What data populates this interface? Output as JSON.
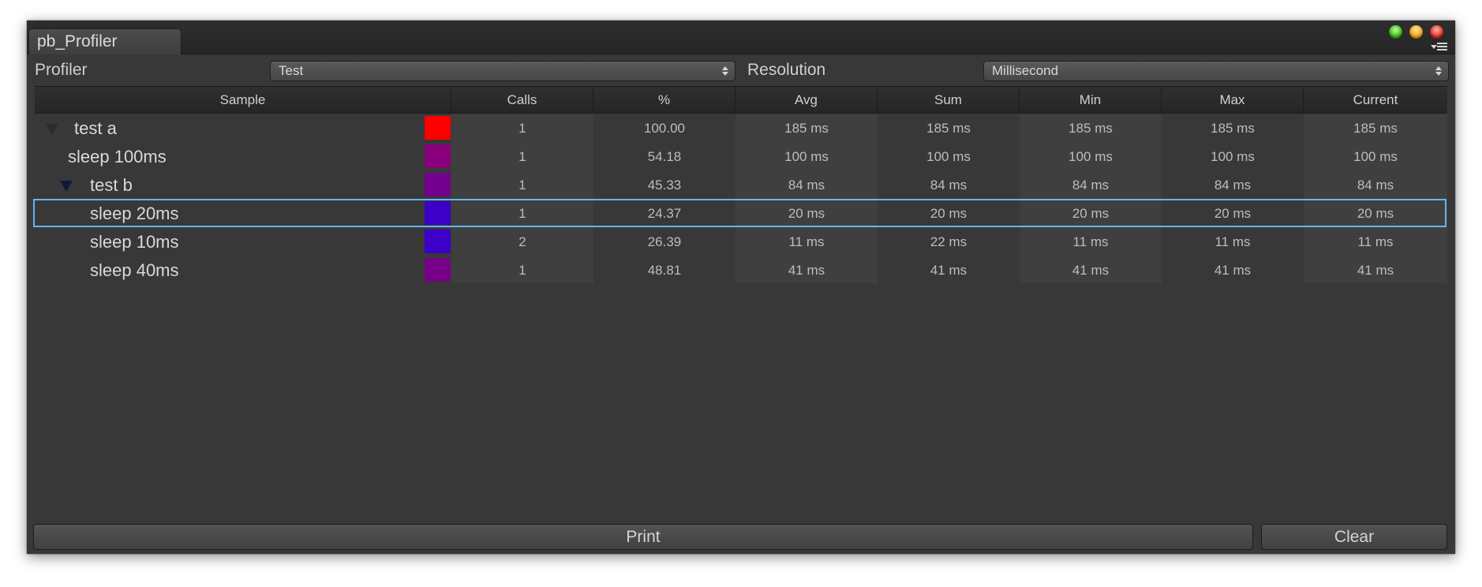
{
  "window": {
    "tab_title": "pb_Profiler"
  },
  "toolbar": {
    "profiler_label": "Profiler",
    "profiler_value": "Test",
    "resolution_label": "Resolution",
    "resolution_value": "Millisecond"
  },
  "table": {
    "headers": [
      "Sample",
      "Calls",
      "%",
      "Avg",
      "Sum",
      "Min",
      "Max",
      "Current"
    ],
    "rows": [
      {
        "name": "test a",
        "toggle": "collapsed-dim",
        "color": "#ff0000",
        "calls": "1",
        "percent": "100.00",
        "avg": "185 ms",
        "sum": "185 ms",
        "min": "185 ms",
        "max": "185 ms",
        "current": "185 ms"
      },
      {
        "name": "sleep 100ms",
        "toggle": "none",
        "color": "#8a007a",
        "calls": "1",
        "percent": "54.18",
        "avg": "100 ms",
        "sum": "100 ms",
        "min": "100 ms",
        "max": "100 ms",
        "current": "100 ms"
      },
      {
        "name": "test b",
        "toggle": "expanded",
        "color": "#74008e",
        "calls": "1",
        "percent": "45.33",
        "avg": "84 ms",
        "sum": "84 ms",
        "min": "84 ms",
        "max": "84 ms",
        "current": "84 ms"
      },
      {
        "name": "sleep 20ms",
        "toggle": "none",
        "color": "#3d00c8",
        "calls": "1",
        "percent": "24.37",
        "avg": "20 ms",
        "sum": "20 ms",
        "min": "20 ms",
        "max": "20 ms",
        "current": "20 ms",
        "selected": true
      },
      {
        "name": "sleep 10ms",
        "toggle": "none",
        "color": "#3d00c8",
        "calls": "2",
        "percent": "26.39",
        "avg": "11 ms",
        "sum": "22 ms",
        "min": "11 ms",
        "max": "11 ms",
        "current": "11 ms"
      },
      {
        "name": "sleep 40ms",
        "toggle": "none",
        "color": "#770088",
        "calls": "1",
        "percent": "48.81",
        "avg": "41 ms",
        "sum": "41 ms",
        "min": "41 ms",
        "max": "41 ms",
        "current": "41 ms"
      }
    ]
  },
  "buttons": {
    "print": "Print",
    "clear": "Clear"
  },
  "colors": {
    "selection": "#5fb7f0",
    "window_bg": "#383838"
  }
}
